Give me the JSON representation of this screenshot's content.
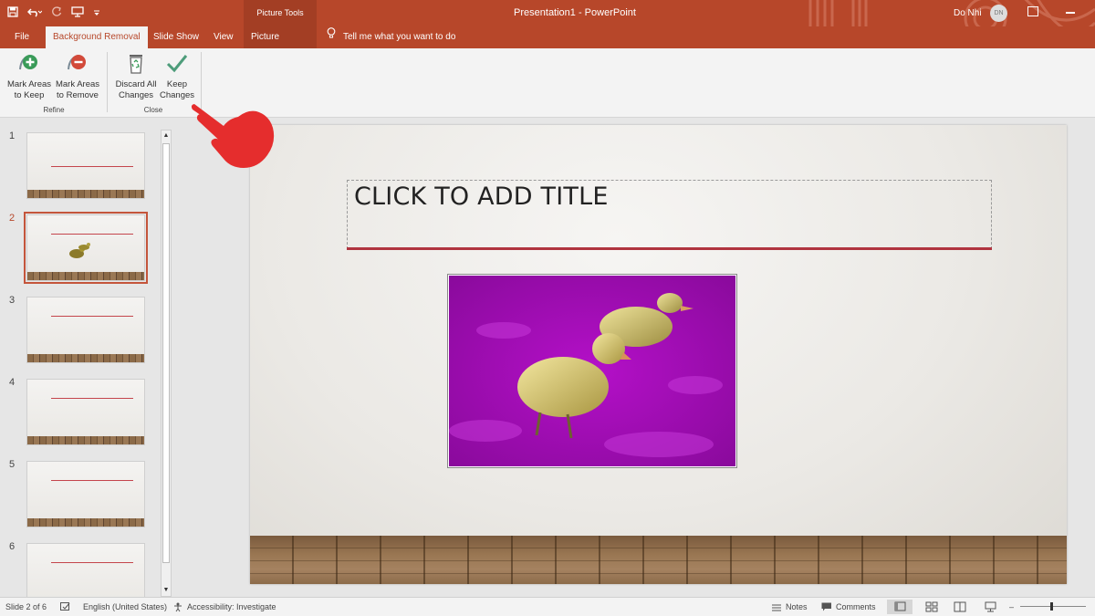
{
  "window": {
    "doc_title": "Presentation1  -  PowerPoint",
    "contextual_header": "Picture Tools",
    "user_name": "Do Nhi",
    "user_initials": "DN"
  },
  "tabs": [
    {
      "label": "File"
    },
    {
      "label": "Background Removal"
    },
    {
      "label": "Slide Show"
    },
    {
      "label": "View"
    },
    {
      "label": "Picture Format"
    }
  ],
  "tell_me": "Tell me what you want to do",
  "ribbon": {
    "mark_keep_line1": "Mark Areas",
    "mark_keep_line2": "to Keep",
    "mark_remove_line1": "Mark Areas",
    "mark_remove_line2": "to Remove",
    "group_refine": "Refine",
    "discard_line1": "Discard All",
    "discard_line2": "Changes",
    "keep_line1": "Keep",
    "keep_line2": "Changes",
    "group_close": "Close"
  },
  "thumbnails": [
    {
      "num": "1"
    },
    {
      "num": "2"
    },
    {
      "num": "3"
    },
    {
      "num": "4"
    },
    {
      "num": "5"
    },
    {
      "num": "6"
    }
  ],
  "slide": {
    "title_placeholder": "CLICK TO ADD TITLE"
  },
  "status": {
    "slide_pos": "Slide 2 of 6",
    "language": "English (United States)",
    "accessibility": "Accessibility: Investigate",
    "notes": "Notes",
    "comments": "Comments"
  },
  "colors": {
    "accent": "#b7472a",
    "removal_overlay": "#b000c8",
    "title_rule": "#b0343f"
  }
}
